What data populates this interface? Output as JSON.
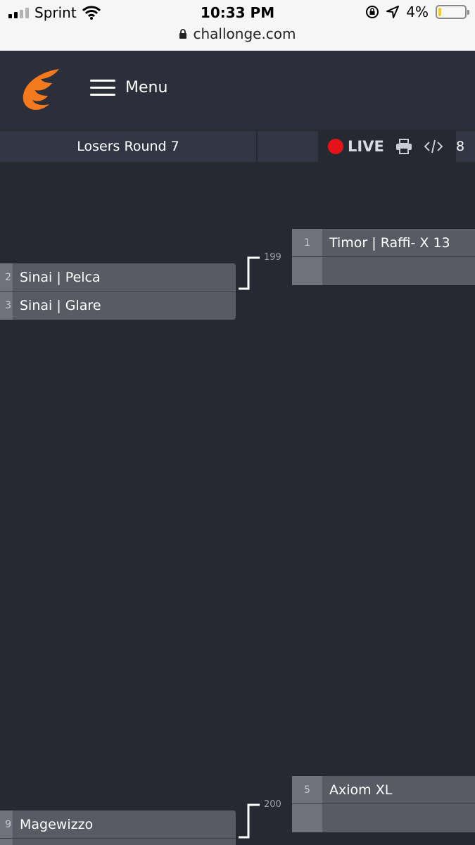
{
  "status": {
    "carrier": "Sprint",
    "time": "10:33 PM",
    "battery": "4%",
    "url": "challonge.com"
  },
  "header": {
    "menu_label": "Menu"
  },
  "roundbar": {
    "round_title": "Losers Round 7",
    "live_label": "LIVE",
    "next_round_peek": "8"
  },
  "matches": [
    {
      "number": "199",
      "incoming": [
        {
          "seed": "2",
          "name": "Sinai | Pelca"
        },
        {
          "seed": "3",
          "name": "Sinai | Glare"
        }
      ],
      "next": [
        {
          "seed": "1",
          "name": "Timor | Raffi- X 13"
        },
        {
          "seed": "",
          "name": ""
        }
      ]
    },
    {
      "number": "200",
      "incoming": [
        {
          "seed": "9",
          "name": "Magewizzo"
        }
      ],
      "next": [
        {
          "seed": "5",
          "name": "Axiom XL"
        },
        {
          "seed": "",
          "name": ""
        }
      ]
    }
  ],
  "colors": {
    "accent": "#f47a20",
    "live": "#e3121b",
    "background": "#262932"
  },
  "icons": [
    "signal-icon",
    "wifi-icon",
    "lock-icon",
    "rotation-lock-icon",
    "location-icon",
    "battery-icon",
    "challonge-logo",
    "hamburger-icon",
    "live-dot-icon",
    "printer-icon",
    "embed-code-icon"
  ]
}
